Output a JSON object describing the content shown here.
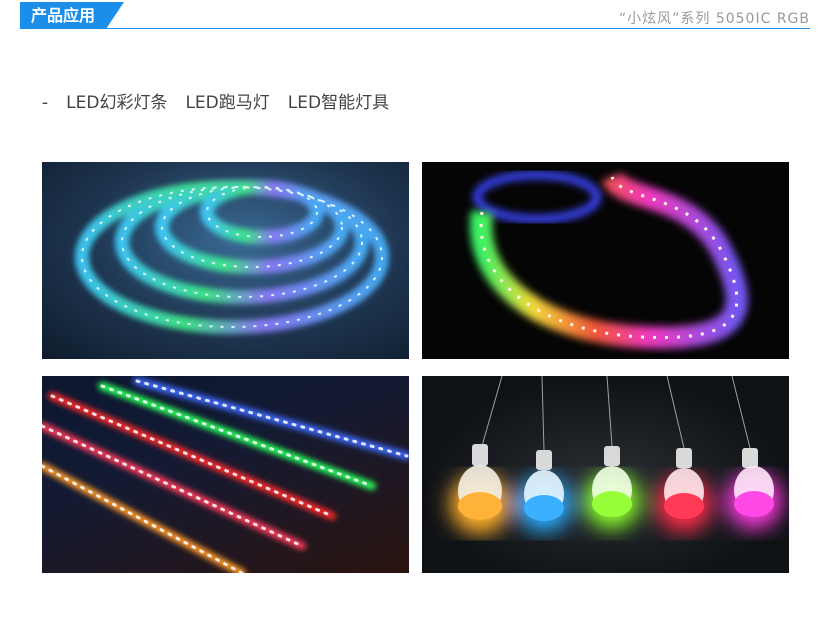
{
  "header": {
    "tag_label": "产品应用",
    "series_label": "“小炫风”系列 5050IC RGB",
    "accent_color": "#1a8ee8"
  },
  "subtitle": {
    "prefix": "-",
    "items": [
      "LED幻彩灯条",
      "LED跑马灯",
      "LED智能灯具"
    ]
  },
  "photos": [
    {
      "name": "rgb-strip-coil-photo"
    },
    {
      "name": "rgb-strip-wave-photo"
    },
    {
      "name": "led-light-bars-photo"
    },
    {
      "name": "smart-led-bulbs-photo"
    }
  ]
}
